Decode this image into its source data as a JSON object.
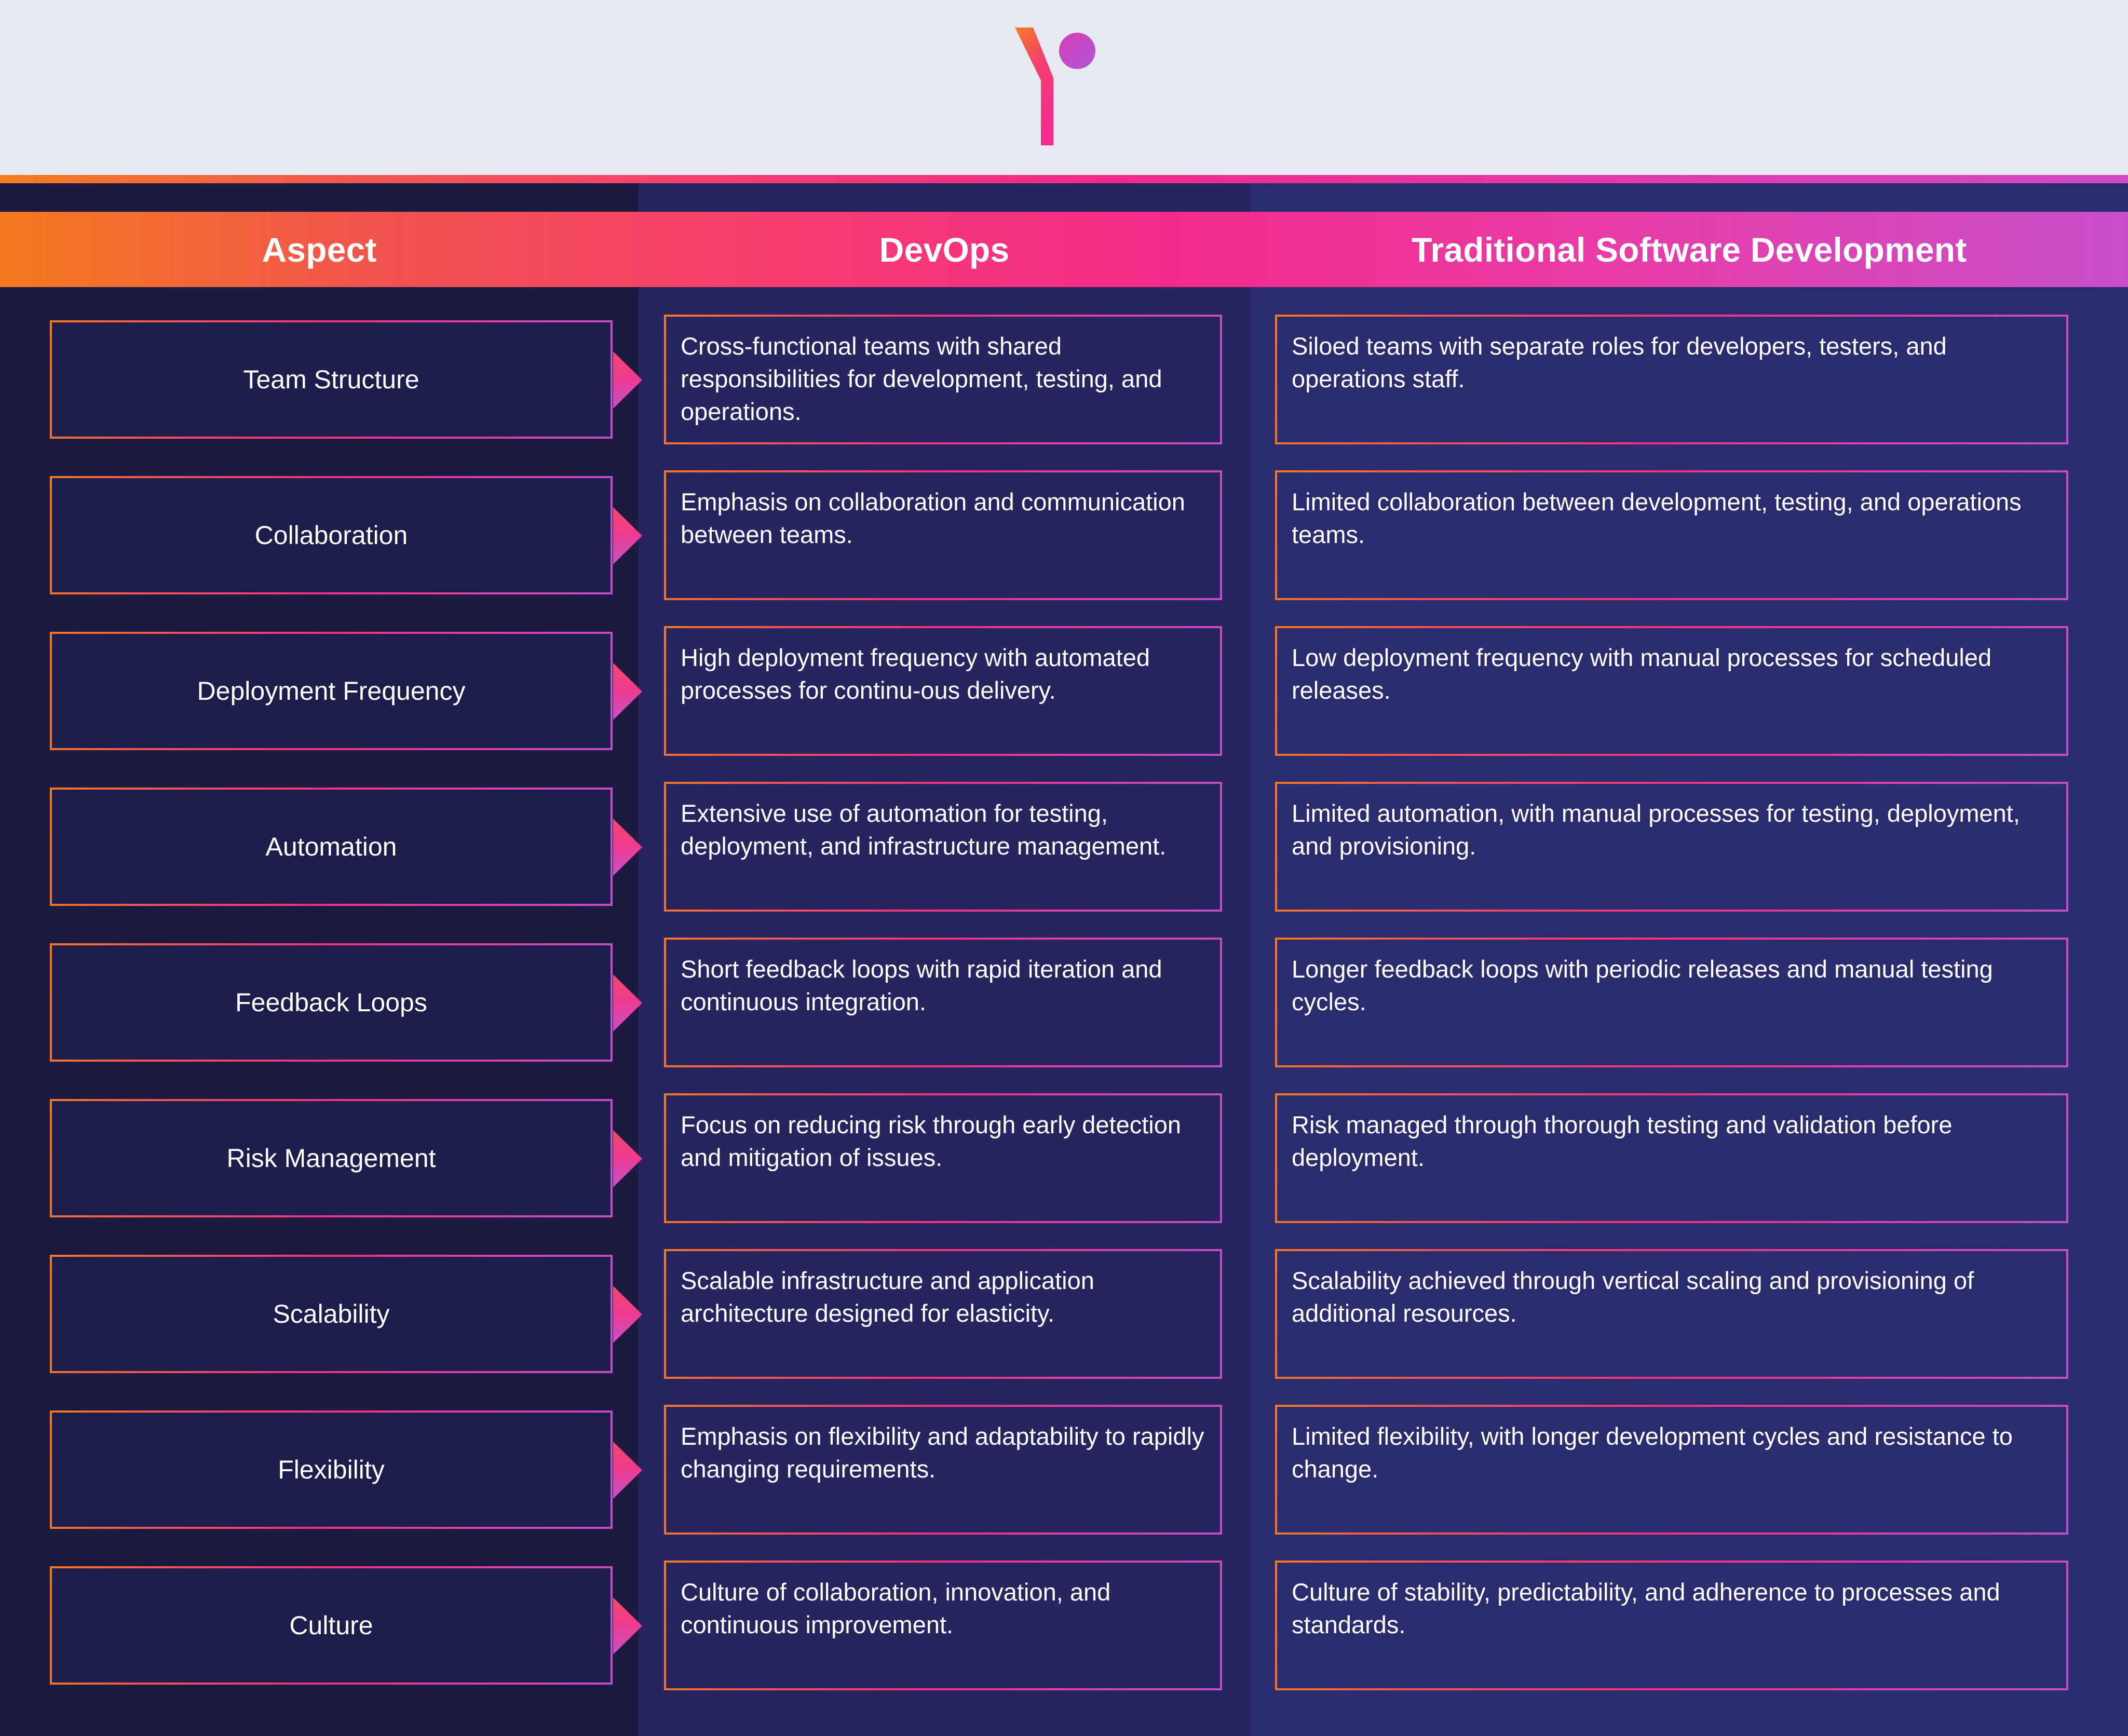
{
  "brand": {
    "logo_icon": "brand-y-logo",
    "colors": {
      "orange": "#f47a20",
      "pink": "#f6317f",
      "magenta": "#e33da4",
      "purple": "#c24fc9",
      "band_bg": "#e7eaf1",
      "col1_bg": "#1b1b42",
      "col2_bg": "#262560",
      "col3_bg": "#2b2c6e"
    }
  },
  "table": {
    "headers": {
      "aspect": "Aspect",
      "devops": "DevOps",
      "traditional": "Traditional Software Development"
    },
    "rows": [
      {
        "aspect": "Team Structure",
        "devops": "Cross-functional teams with shared responsibilities for development, testing, and operations.",
        "traditional": "Siloed teams with separate roles for developers, testers, and operations staff."
      },
      {
        "aspect": "Collaboration",
        "devops": "Emphasis on collaboration and communication between teams.",
        "traditional": "Limited collaboration between development, testing, and operations teams."
      },
      {
        "aspect": "Deployment Frequency",
        "devops": "High deployment frequency with automated processes for continu-ous delivery.",
        "traditional": "Low deployment frequency with manual processes for scheduled releases."
      },
      {
        "aspect": "Automation",
        "devops": "Extensive use of automation for testing, deployment, and infrastructure management.",
        "traditional": "Limited automation, with manual processes for testing, deployment, and provisioning."
      },
      {
        "aspect": "Feedback Loops",
        "devops": "Short feedback loops with rapid iteration and continuous integration.",
        "traditional": "Longer feedback loops with periodic releases and manual testing cycles."
      },
      {
        "aspect": "Risk Management",
        "devops": "Focus on reducing risk through early detection and mitigation of issues.",
        "traditional": "Risk managed through thorough testing and validation before deployment."
      },
      {
        "aspect": "Scalability",
        "devops": "Scalable infrastructure and application architecture designed for elasticity.",
        "traditional": "Scalability achieved through vertical scaling and provisioning of additional resources."
      },
      {
        "aspect": "Flexibility",
        "devops": "Emphasis on flexibility and adaptability to rapidly changing requirements.",
        "traditional": "Limited flexibility, with longer development cycles and resistance to change."
      },
      {
        "aspect": "Culture",
        "devops": "Culture of collaboration, innovation, and continuous improvement.",
        "traditional": "Culture of stability, predictability, and adherence to processes and standards."
      }
    ]
  }
}
